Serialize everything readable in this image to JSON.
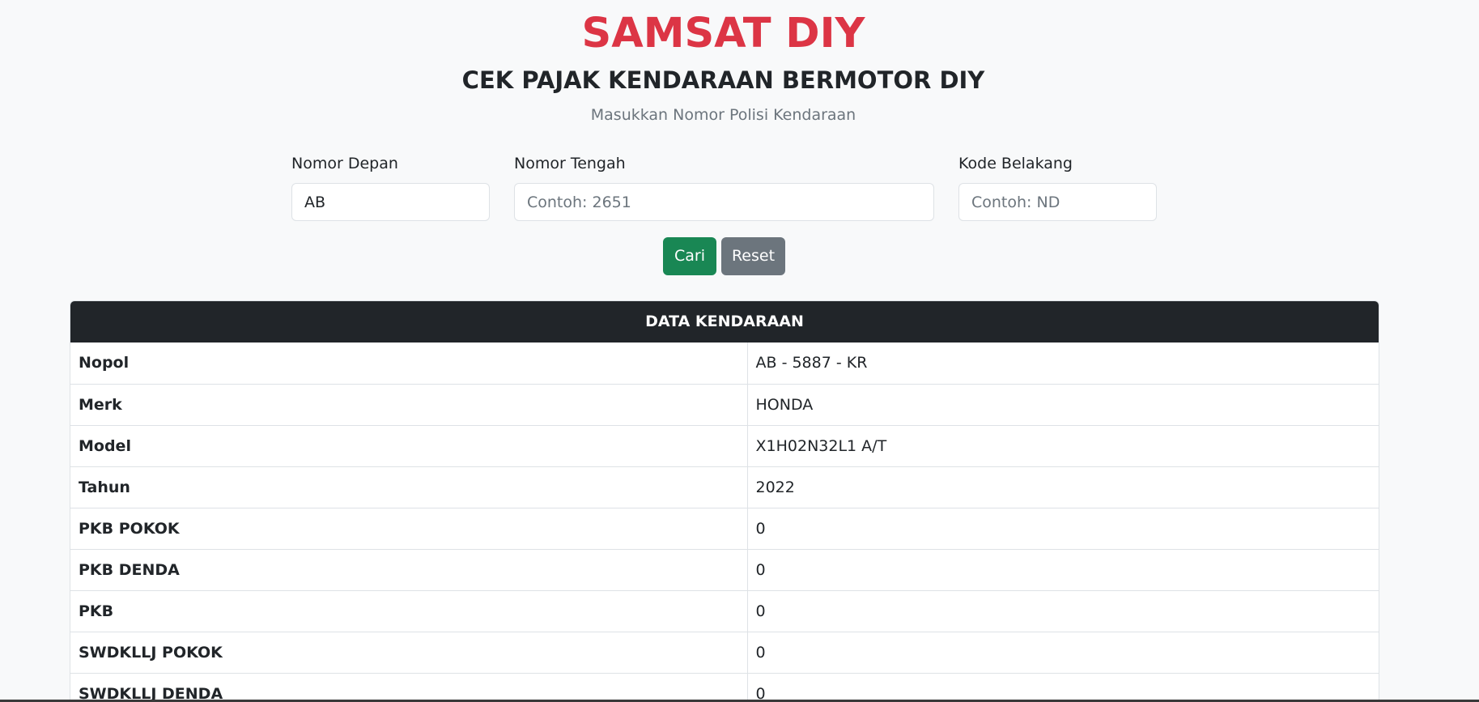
{
  "header": {
    "brand": "SAMSAT DIY",
    "title": "CEK PAJAK KENDARAAN BERMOTOR DIY",
    "hint": "Masukkan Nomor Polisi Kendaraan"
  },
  "form": {
    "front": {
      "label": "Nomor Depan",
      "value": "AB",
      "placeholder": ""
    },
    "middle": {
      "label": "Nomor Tengah",
      "value": "",
      "placeholder": "Contoh: 2651"
    },
    "back": {
      "label": "Kode Belakang",
      "value": "",
      "placeholder": "Contoh: ND"
    },
    "search_label": "Cari",
    "reset_label": "Reset"
  },
  "colors": {
    "brand": "#dc3545",
    "search_button": "#198754",
    "reset_button": "#6c757d",
    "card_header": "#212529"
  },
  "data_card": {
    "title": "DATA KENDARAAN",
    "rows": [
      {
        "key": "Nopol",
        "value": "AB - 5887 - KR"
      },
      {
        "key": "Merk",
        "value": "HONDA"
      },
      {
        "key": "Model",
        "value": "X1H02N32L1 A/T"
      },
      {
        "key": "Tahun",
        "value": "2022"
      },
      {
        "key": "PKB POKOK",
        "value": "0"
      },
      {
        "key": "PKB DENDA",
        "value": "0"
      },
      {
        "key": "PKB",
        "value": "0"
      },
      {
        "key": "SWDKLLJ POKOK",
        "value": "0"
      },
      {
        "key": "SWDKLLJ DENDA",
        "value": "0"
      }
    ]
  }
}
